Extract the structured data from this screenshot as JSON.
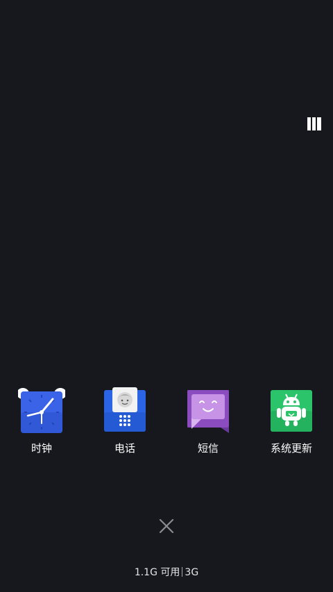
{
  "apps": [
    {
      "label": "时钟",
      "icon": "clock-icon",
      "color": "#3a63e8"
    },
    {
      "label": "电话",
      "icon": "phone-icon",
      "color": "#2c64e6"
    },
    {
      "label": "短信",
      "icon": "message-icon",
      "color": "#9a57c2"
    },
    {
      "label": "系统更新",
      "icon": "system-update-icon",
      "color": "#2bc46a"
    }
  ],
  "controls": {
    "layout_toggle_icon": "layout-grid-icon",
    "close_all_icon": "close-icon"
  },
  "status": {
    "memory_available": "1.1G 可用",
    "memory_total": "3G"
  }
}
